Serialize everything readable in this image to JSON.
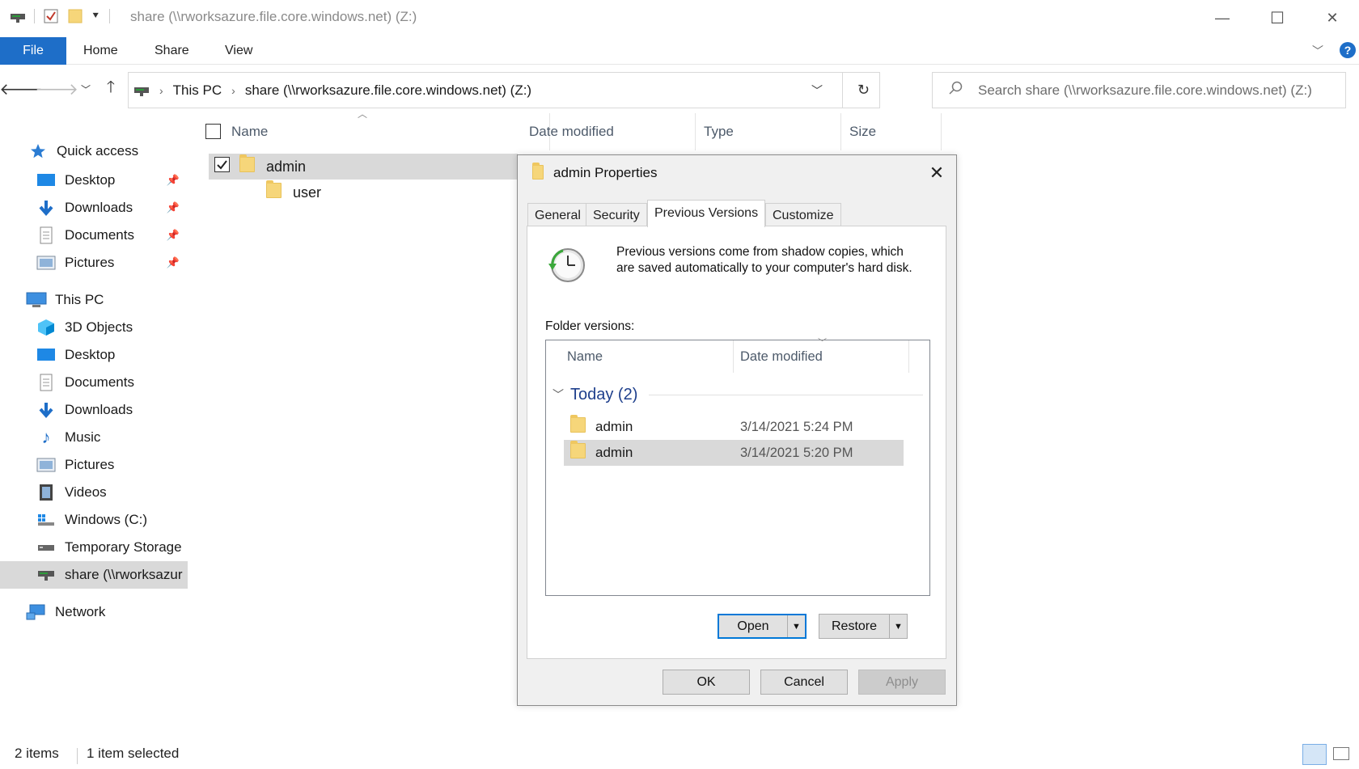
{
  "window": {
    "title": "share (\\\\rworksazure.file.core.windows.net) (Z:)",
    "controls": {
      "minimize": "—",
      "maximize": "☐",
      "close": "✕"
    }
  },
  "ribbon": {
    "tabs": [
      "File",
      "Home",
      "Share",
      "View"
    ]
  },
  "navigation": {
    "breadcrumb": [
      "This PC",
      "share (\\\\rworksazure.file.core.windows.net) (Z:)"
    ],
    "search_placeholder": "Search share (\\\\rworksazure.file.core.windows.net) (Z:)"
  },
  "sidebar": {
    "quick_access": {
      "label": "Quick access",
      "items": [
        "Desktop",
        "Downloads",
        "Documents",
        "Pictures"
      ]
    },
    "this_pc": {
      "label": "This PC",
      "items": [
        "3D Objects",
        "Desktop",
        "Documents",
        "Downloads",
        "Music",
        "Pictures",
        "Videos",
        "Windows (C:)",
        "Temporary Storage",
        "share (\\\\rworksazur"
      ]
    },
    "network": "Network"
  },
  "file_list": {
    "columns": [
      "Name",
      "Date modified",
      "Type",
      "Size"
    ],
    "rows": [
      {
        "name": "admin",
        "selected": true
      },
      {
        "name": "user",
        "selected": false
      }
    ]
  },
  "status_bar": {
    "items": "2 items",
    "selected": "1 item selected"
  },
  "dialog": {
    "title": "admin Properties",
    "tabs": [
      "General",
      "Security",
      "Previous Versions",
      "Customize"
    ],
    "active_tab": "Previous Versions",
    "description_line1": "Previous versions come from shadow copies, which",
    "description_line2": "are saved automatically to your computer's hard disk.",
    "folder_versions_label": "Folder versions:",
    "columns": [
      "Name",
      "Date modified"
    ],
    "group": "Today (2)",
    "versions": [
      {
        "name": "admin",
        "date": "3/14/2021 5:24 PM",
        "selected": false
      },
      {
        "name": "admin",
        "date": "3/14/2021 5:20 PM",
        "selected": true
      }
    ],
    "buttons": {
      "open": "Open",
      "restore": "Restore",
      "ok": "OK",
      "cancel": "Cancel",
      "apply": "Apply"
    }
  },
  "colors": {
    "accent": "#1e6ec8",
    "selection": "#d9d9d9",
    "folder": "#f6d67a",
    "group_header": "#1e3f8c"
  }
}
